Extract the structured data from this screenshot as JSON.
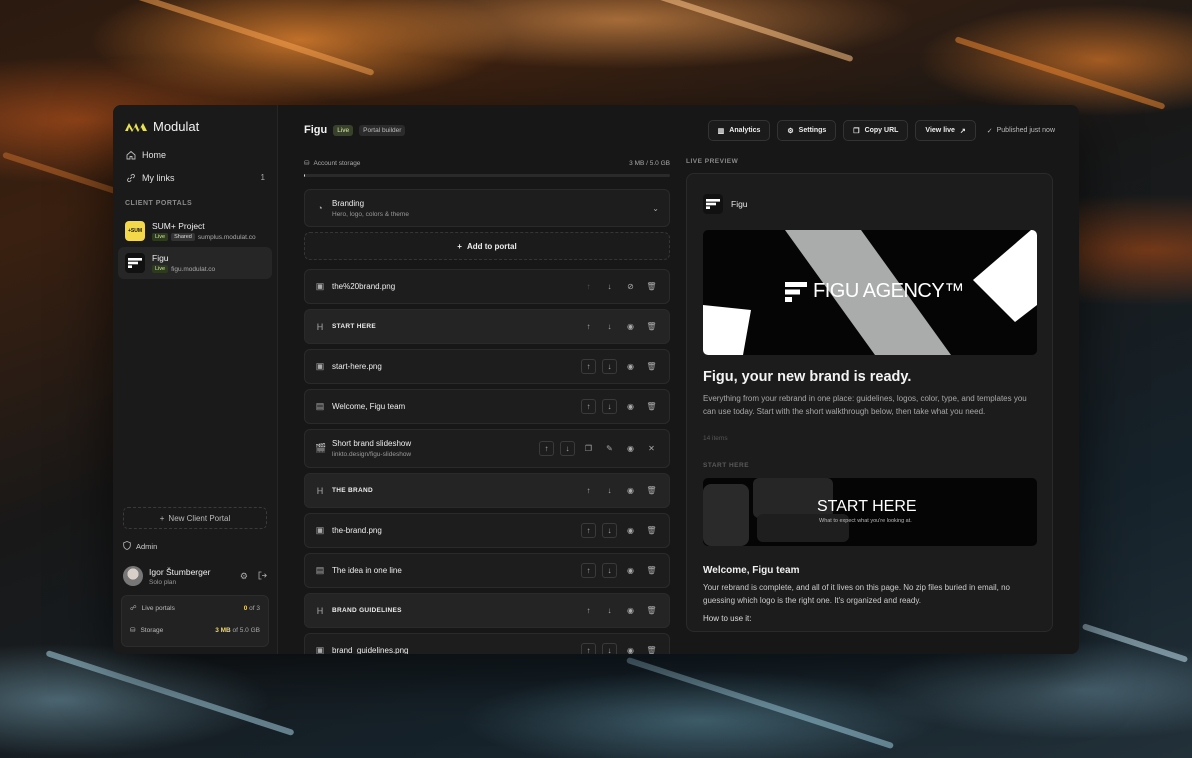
{
  "sidebar": {
    "brand": "Modulat",
    "nav": [
      {
        "label": "Home",
        "icon": "home-icon"
      },
      {
        "label": "My links",
        "icon": "link-icon",
        "count": "1"
      }
    ],
    "section_label": "CLIENT PORTALS",
    "portals": [
      {
        "name": "SUM+ Project",
        "logo_text": "+SUM",
        "tags": [
          "Live",
          "Shared"
        ],
        "domain": "sumplus.modulat.co"
      },
      {
        "name": "Figu",
        "tags": [
          "Live"
        ],
        "domain": "figu.modulat.co"
      }
    ],
    "new_portal": "New Client Portal",
    "admin": "Admin",
    "user": {
      "name": "Igor Štumberger",
      "plan": "Solo plan"
    },
    "stats": [
      {
        "label": "Live portals",
        "value_strong": "0",
        "value_rest": " of 3"
      },
      {
        "label": "Storage",
        "value_strong": "3 MB",
        "value_rest": " of 5.0 GB"
      }
    ]
  },
  "header": {
    "title": "Figu",
    "live_badge": "Live",
    "builder_badge": "Portal builder",
    "buttons": {
      "analytics": "Analytics",
      "settings": "Settings",
      "copy_url": "Copy URL",
      "view_live": "View live"
    },
    "published": "Published just now"
  },
  "storage": {
    "label": "Account storage",
    "value": "3 MB / 5.0 GB",
    "fraction": 0.0006
  },
  "branding": {
    "title": "Branding",
    "subtitle": "Hero, logo, colors & theme"
  },
  "add_label": "Add to portal",
  "items": {
    "i1": {
      "label": "the%20brand.png"
    },
    "i2": {
      "label": "START HERE"
    },
    "i3": {
      "label": "start-here.png"
    },
    "i4": {
      "label": "Welcome, Figu team"
    },
    "i5": {
      "label": "Short brand slideshow",
      "sub": "linkto.design/figu-slideshow"
    },
    "i6": {
      "label": "THE BRAND"
    },
    "i7": {
      "label": "the-brand.png"
    },
    "i8": {
      "label": "The idea in one line"
    },
    "i9": {
      "label": "BRAND GUIDELINES"
    },
    "i10": {
      "label": "brand_guidelines.png"
    }
  },
  "preview": {
    "label": "LIVE PREVIEW",
    "name": "Figu",
    "hero_text": "FIGU AGENCY™",
    "headline": "Figu, your new brand is ready.",
    "intro": "Everything from your rebrand in one place: guidelines, logos, color, type, and templates you can use today. Start with the short walkthrough below, then take what you need.",
    "count": "14 items",
    "section": "START HERE",
    "start_title": "START HERE",
    "start_sub": "What to expect what you're looking at.",
    "welcome_title": "Welcome, Figu team",
    "welcome_text": "Your rebrand is complete, and all of it lives on this page. No zip files buried in email, no guessing which logo is the right one. It's organized and ready.",
    "howto": "How to use it:"
  },
  "colors": {
    "accent": "#f0d468",
    "sum_logo": "#f3d84a",
    "live_badge": "#38422a"
  }
}
